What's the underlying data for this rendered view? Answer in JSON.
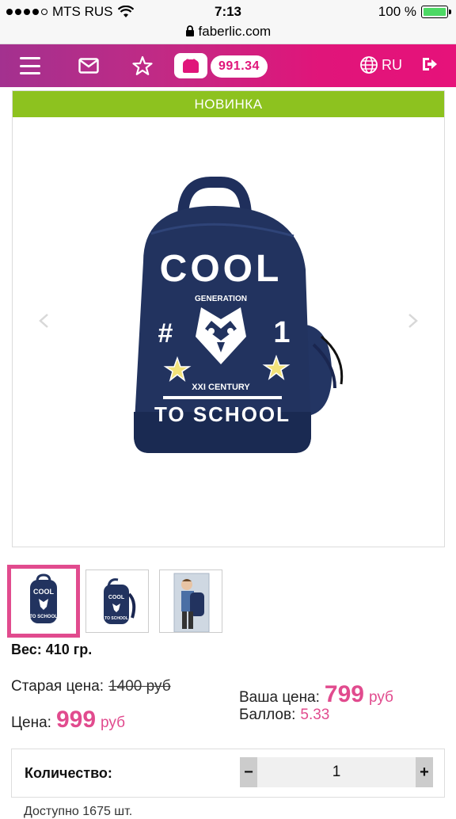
{
  "status_bar": {
    "carrier": "MTS RUS",
    "time": "7:13",
    "battery": "100 %",
    "battery_level": 1.0
  },
  "url_bar": {
    "domain": "faberlic.com"
  },
  "navbar": {
    "balance": "991.34",
    "language": "RU",
    "icons": [
      "menu-icon",
      "mail-icon",
      "star-icon",
      "wallet-icon",
      "globe-icon",
      "logout-icon"
    ]
  },
  "product": {
    "badge": "НОВИНКА",
    "image_text": {
      "top": "COOL",
      "generation": "GENERATION",
      "hash": "#",
      "number": "1",
      "century": "XXI CENTURY",
      "bottom": "TO SCHOOL"
    },
    "weight": "Вес: 410 гр."
  },
  "pricing": {
    "old_price_label": "Старая цена:",
    "old_price_value": "1400",
    "old_price_currency": "руб",
    "price_label": "Цена:",
    "price_value": "999",
    "price_currency": "руб",
    "your_price_label": "Ваша цена:",
    "your_price_value": "799",
    "your_price_currency": "руб",
    "points_label": "Баллов:",
    "points_value": "5.33"
  },
  "quantity": {
    "label": "Количество:",
    "minus": "−",
    "plus": "+",
    "value": "1"
  },
  "available": "Доступно 1675 шт.",
  "colors": {
    "nav_gradient_start": "#a3318f",
    "nav_gradient_end": "#e6127a",
    "badge_green": "#8dc21f",
    "accent_pink": "#e14b8e",
    "backpack_navy": "#1f2f5c"
  }
}
